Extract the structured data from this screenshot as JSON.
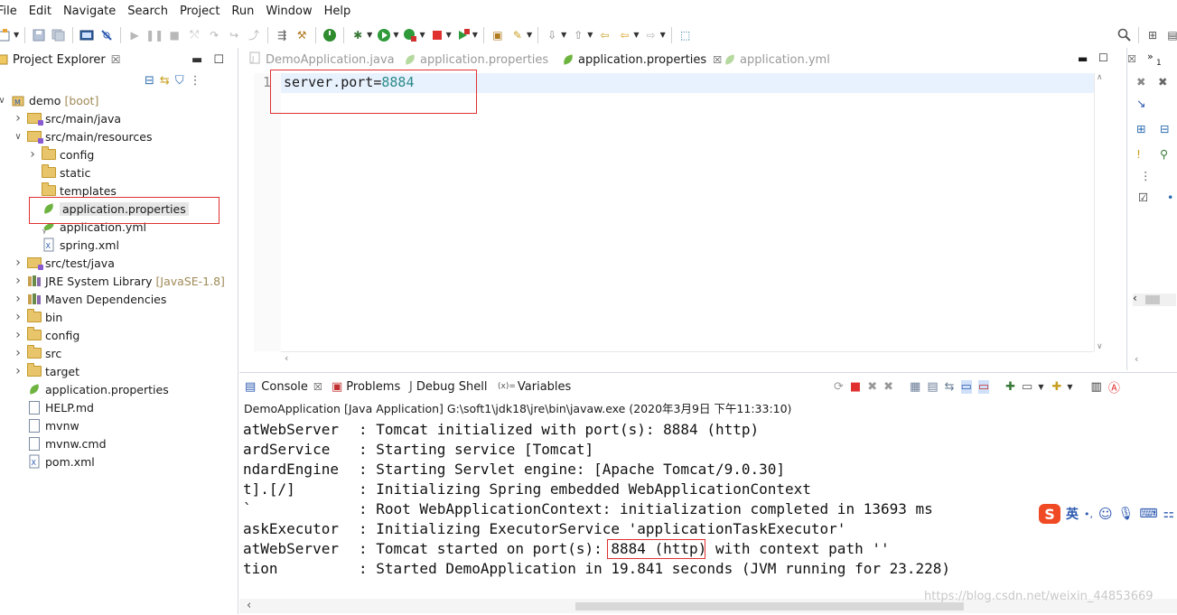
{
  "menu": [
    "File",
    "Edit",
    "Navigate",
    "Search",
    "Project",
    "Run",
    "Window",
    "Help"
  ],
  "explorer": {
    "title": "Project Explorer",
    "tree": [
      {
        "label": "demo",
        "deco": "[boot]",
        "depth": 0,
        "expanded": true,
        "icon": "project-icon"
      },
      {
        "label": "src/main/java",
        "deco": "",
        "depth": 1,
        "expanded": false,
        "icon": "package-folder-icon"
      },
      {
        "label": "src/main/resources",
        "deco": "",
        "depth": 1,
        "expanded": true,
        "icon": "package-folder-icon"
      },
      {
        "label": "config",
        "deco": "",
        "depth": 2,
        "expanded": false,
        "icon": "folder-icon"
      },
      {
        "label": "static",
        "deco": "",
        "depth": 2,
        "icon": "folder-icon"
      },
      {
        "label": "templates",
        "deco": "",
        "depth": 2,
        "icon": "folder-icon"
      },
      {
        "label": "application.properties",
        "deco": "",
        "depth": 2,
        "icon": "spring-leaf-icon",
        "selected": true
      },
      {
        "label": "application.yml",
        "deco": "",
        "depth": 2,
        "icon": "spring-yml-icon"
      },
      {
        "label": "spring.xml",
        "deco": "",
        "depth": 2,
        "icon": "xml-file-icon"
      },
      {
        "label": "src/test/java",
        "deco": "",
        "depth": 1,
        "expanded": false,
        "icon": "package-folder-icon"
      },
      {
        "label": "JRE System Library",
        "deco": "[JavaSE-1.8]",
        "depth": 1,
        "expanded": false,
        "icon": "library-icon"
      },
      {
        "label": "Maven Dependencies",
        "deco": "",
        "depth": 1,
        "expanded": false,
        "icon": "library-icon"
      },
      {
        "label": "bin",
        "deco": "",
        "depth": 1,
        "expanded": false,
        "icon": "folder-icon"
      },
      {
        "label": "config",
        "deco": "",
        "depth": 1,
        "expanded": false,
        "icon": "folder-icon"
      },
      {
        "label": "src",
        "deco": "",
        "depth": 1,
        "expanded": false,
        "icon": "folder-icon"
      },
      {
        "label": "target",
        "deco": "",
        "depth": 1,
        "expanded": false,
        "icon": "folder-icon"
      },
      {
        "label": "application.properties",
        "deco": "",
        "depth": 1,
        "icon": "spring-leaf-icon"
      },
      {
        "label": "HELP.md",
        "deco": "",
        "depth": 1,
        "icon": "md-file-icon"
      },
      {
        "label": "mvnw",
        "deco": "",
        "depth": 1,
        "icon": "text-file-icon"
      },
      {
        "label": "mvnw.cmd",
        "deco": "",
        "depth": 1,
        "icon": "text-file-icon"
      },
      {
        "label": "pom.xml",
        "deco": "",
        "depth": 1,
        "icon": "xml-file-icon"
      }
    ]
  },
  "editor": {
    "tabs": [
      {
        "label": "DemoApplication.java",
        "active": false
      },
      {
        "label": "application.properties",
        "active": false
      },
      {
        "label": "application.properties",
        "active": true
      },
      {
        "label": "application.yml",
        "active": false
      }
    ],
    "line_number": "1",
    "code_key": "server.port=",
    "code_value": "8884"
  },
  "console": {
    "tabs": [
      "Console",
      "Problems",
      "Debug Shell",
      "Variables"
    ],
    "variables_prefix": "(x)=",
    "launch_info": "DemoApplication [Java Application] G:\\soft1\\jdk18\\jre\\bin\\javaw.exe (2020年3月9日 下午11:33:10)",
    "lines": [
      {
        "src": "atWebServer",
        "msg": "Tomcat initialized with port(s): 8884 (http)"
      },
      {
        "src": "ardService",
        "msg": "Starting service [Tomcat]"
      },
      {
        "src": "ndardEngine",
        "msg": "Starting Servlet engine: [Apache Tomcat/9.0.30]"
      },
      {
        "src": "t].[/]",
        "msg": "Initializing Spring embedded WebApplicationContext"
      },
      {
        "src": "`",
        "msg": "Root WebApplicationContext: initialization completed in 13693 ms"
      },
      {
        "src": "askExecutor",
        "msg": "Initializing ExecutorService 'applicationTaskExecutor'"
      },
      {
        "src": "atWebServer",
        "msg": "Tomcat started on port(s): 8884 (http) with context path ''"
      },
      {
        "src": "tion",
        "msg": "Started DemoApplication in 19.841 seconds (JVM running for 23.228)"
      }
    ],
    "watermark": "https://blog.csdn.net/weixin_44853669"
  },
  "ime": {
    "lang": "英",
    "punct": "•,"
  },
  "right_panel": {
    "tab_number": "1"
  }
}
